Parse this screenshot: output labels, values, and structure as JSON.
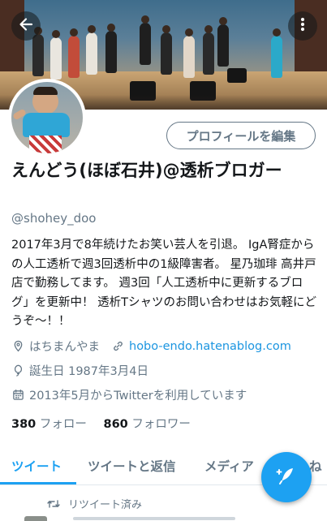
{
  "header": {
    "back_icon": "arrow-left-icon",
    "more_icon": "more-vertical-icon"
  },
  "profile": {
    "edit_button": "プロフィールを編集",
    "name": "えんどう(ほぼ石井)@透析ブロガー",
    "handle": "@shohey_doo",
    "bio": "2017年3月で8年続けたお笑い芸人を引退。 IgA腎症からの人工透析で週3回透析中の1級障害者。 星乃珈琲 高井戸店で勤務してます。 週3回「人工透析中に更新するブログ」を更新中！ 透析Tシャツのお問い合わせはお気軽にどうぞ～！！",
    "location": "はちまんやま",
    "website": "hobo-endo.hatenablog.com",
    "birthday": "誕生日 1987年3月4日",
    "joined": "2013年5月からTwitterを利用しています",
    "following_count": "380",
    "following_label": "フォロー",
    "followers_count": "860",
    "followers_label": "フォロワー"
  },
  "tabs": [
    {
      "label": "ツイート",
      "active": true
    },
    {
      "label": "ツイートと返信",
      "active": false
    },
    {
      "label": "メディア",
      "active": false
    },
    {
      "label": "いいね",
      "active": false
    }
  ],
  "feed": {
    "retweet_label": "リツイート済み"
  },
  "colors": {
    "accent": "#1da1f2",
    "link": "#1b95e0",
    "secondary_text": "#657786"
  }
}
